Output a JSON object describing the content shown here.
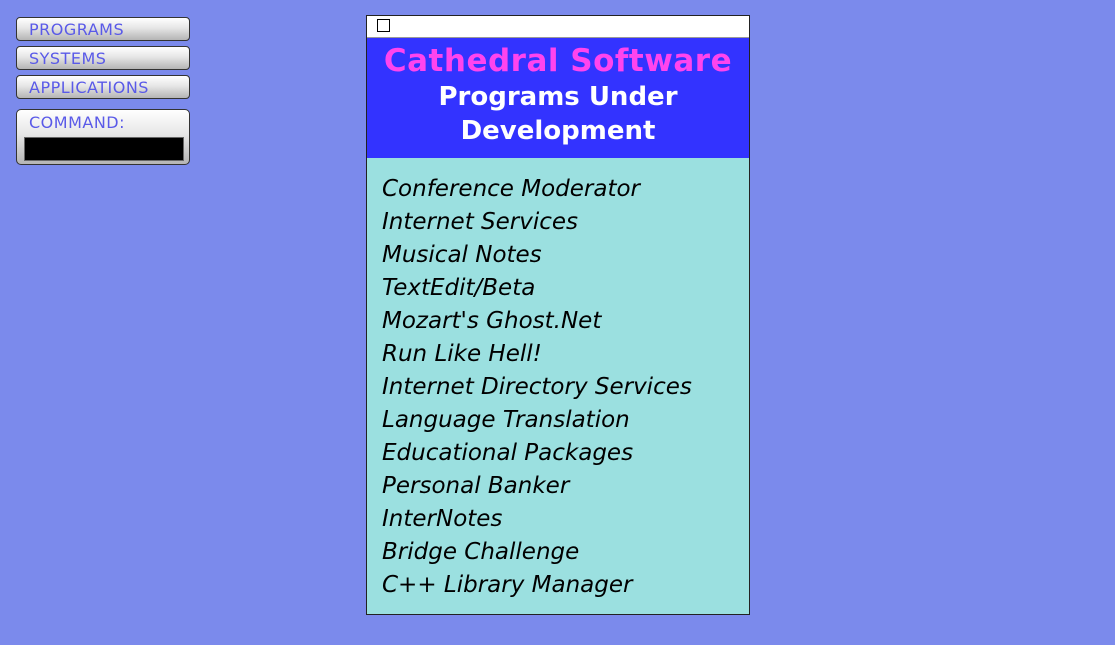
{
  "nav": {
    "programs_label": "PROGRAMS",
    "systems_label": "SYSTEMS",
    "applications_label": "APPLICATIONS"
  },
  "command": {
    "label": "COMMAND:",
    "value": ""
  },
  "header": {
    "brand": "Cathedral Software",
    "heading": "Programs Under Development"
  },
  "programs": [
    "Conference Moderator",
    "Internet Services",
    "Musical Notes",
    "TextEdit/Beta",
    "Mozart's Ghost.Net",
    "Run Like Hell!",
    "Internet Directory Services",
    "Language Translation",
    "Educational Packages",
    "Personal Banker",
    "InterNotes",
    "Bridge Challenge",
    "C++ Library Manager"
  ],
  "colors": {
    "background": "#7b8aec",
    "header_bg": "#3333ff",
    "brand_text": "#ff44ee",
    "list_bg": "#9be0e0",
    "nav_text": "#5a5ae8"
  }
}
